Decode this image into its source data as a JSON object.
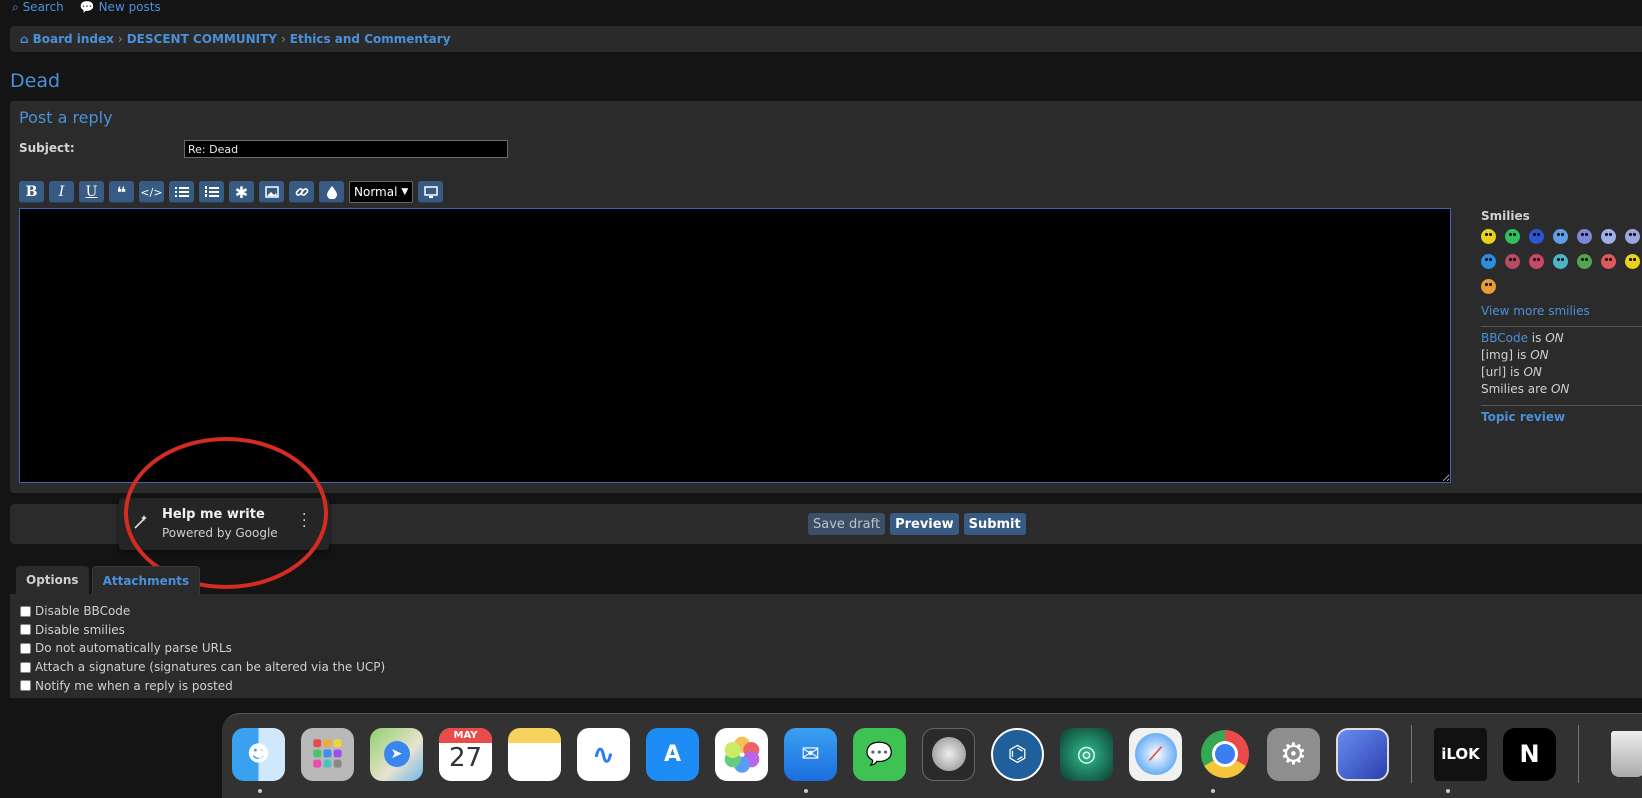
{
  "topnav": {
    "search": "Search",
    "new_posts": "New posts"
  },
  "breadcrumb": {
    "board_index": "Board index",
    "community": "DESCENT COMMUNITY",
    "forum": "Ethics and Commentary"
  },
  "topic": {
    "title": "Dead"
  },
  "form": {
    "heading": "Post a reply",
    "subject_label": "Subject:",
    "subject_value": "Re: Dead",
    "font_size": "Normal"
  },
  "toolbar_icons": [
    "bold-icon",
    "italic-icon",
    "underline-icon",
    "quote-icon",
    "code-icon",
    "list-icon",
    "ordered-list-icon",
    "list-item-icon",
    "image-icon",
    "link-icon",
    "color-icon"
  ],
  "sidebar": {
    "smilies_heading": "Smilies",
    "view_more": "View more smilies",
    "bbcode_link": "BBCode",
    "bbcode_status": " is ",
    "on": "ON",
    "img_label": "[img] is ",
    "url_label": "[url] is ",
    "smilies_label": "Smilies are ",
    "topic_review": "Topic review",
    "smiley_colors": [
      "#e8d21c",
      "#2fbf5b",
      "#2a56d6",
      "#5da0e6",
      "#7d86d8",
      "#9db0e8",
      "#9da4df",
      "#2a8fe0",
      "#b84b63",
      "#c7486a",
      "#4cb5c7",
      "#4fa64d",
      "#e0585a",
      "#e8d21c",
      "#e89c32"
    ]
  },
  "buttons": {
    "save_draft": "Save draft",
    "preview": "Preview",
    "submit": "Submit"
  },
  "help_me_write": {
    "title": "Help me write",
    "subtitle": "Powered by Google"
  },
  "tabs": {
    "options": "Options",
    "attachments": "Attachments"
  },
  "options": [
    "Disable BBCode",
    "Disable smilies",
    "Do not automatically parse URLs",
    "Attach a signature (signatures can be altered via the UCP)",
    "Notify me when a reply is posted"
  ],
  "dock": {
    "calendar_month": "MAY",
    "calendar_day": "27",
    "ilok_label": "iLOK",
    "ni_label": "N",
    "apps": [
      "finder-icon",
      "launchpad-icon",
      "maps-icon",
      "calendar-icon",
      "notes-icon",
      "freeform-icon",
      "app-store-icon",
      "photos-icon",
      "mail-icon",
      "messages-icon",
      "logic-icon",
      "ilok-license-icon",
      "antares-icon",
      "safari-icon",
      "chrome-icon",
      "system-settings-icon",
      "preview-icon",
      "ilok-icon",
      "native-instruments-icon",
      "trash-icon"
    ]
  }
}
